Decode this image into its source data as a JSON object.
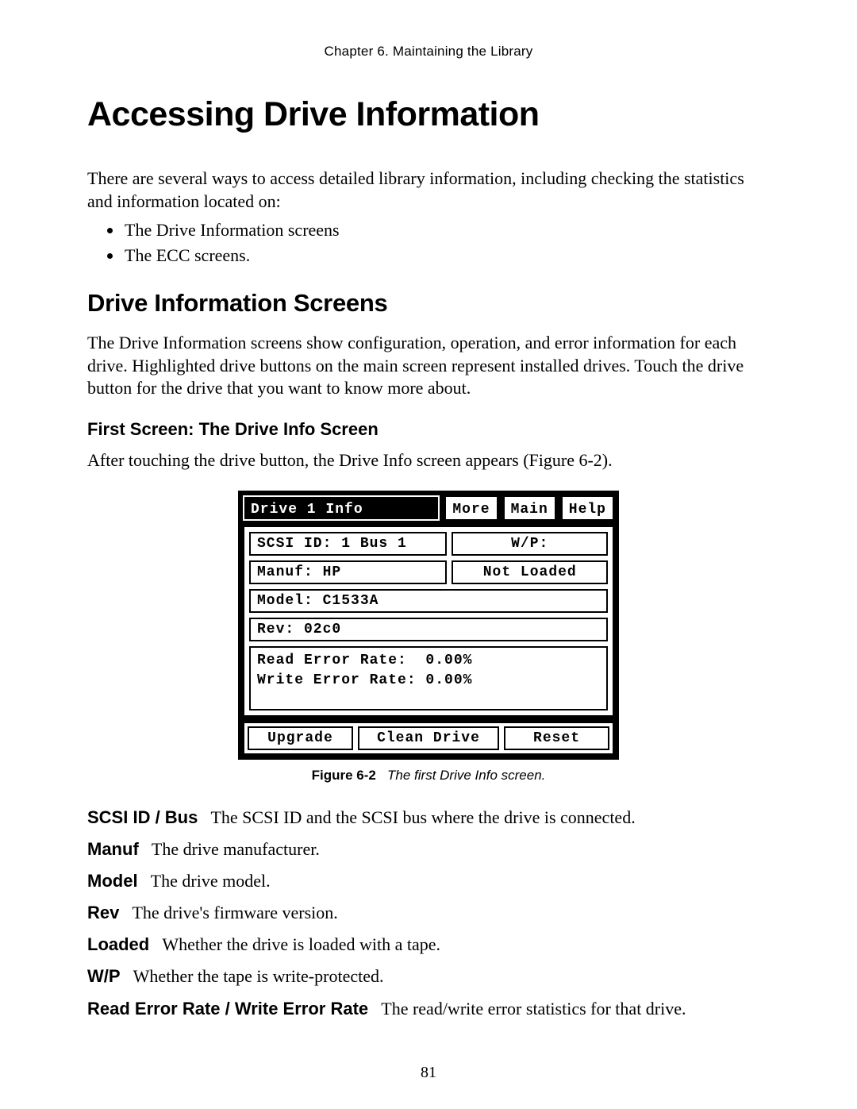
{
  "chapter_line": "Chapter 6.  Maintaining the Library",
  "title": "Accessing Drive Information",
  "intro": "There are several ways to access detailed library information, including checking the statistics and information located on:",
  "intro_bullets": [
    "The Drive Information screens",
    "The ECC screens."
  ],
  "section_title": "Drive Information Screens",
  "section_body": "The Drive Information screens show configuration, operation, and error information for each drive. Highlighted drive buttons on the main screen represent installed drives. Touch the drive button for the drive that you want to know more about.",
  "subsection_title": "First Screen: The Drive Info Screen",
  "subsection_body": "After touching the drive button, the Drive Info screen appears (Figure 6-2).",
  "screen": {
    "header_title": "Drive 1 Info",
    "top_buttons": [
      "More",
      "Main",
      "Help"
    ],
    "scsi": "SCSI ID: 1 Bus 1",
    "wp": "W/P:",
    "manuf": "Manuf: HP",
    "load": "Not Loaded",
    "model": "Model: C1533A",
    "rev": "Rev: 02c0",
    "read_rate": "Read Error Rate:  0.00%",
    "write_rate": "Write Error Rate: 0.00%",
    "bottom_buttons": [
      "Upgrade",
      "Clean Drive",
      "Reset"
    ]
  },
  "caption_label": "Figure 6-2",
  "caption_text": "The first Drive Info screen.",
  "definitions": [
    {
      "term": "SCSI ID / Bus",
      "desc": "The SCSI ID and the SCSI bus where the drive is connected."
    },
    {
      "term": "Manuf",
      "desc": "The drive manufacturer."
    },
    {
      "term": "Model",
      "desc": "The drive model."
    },
    {
      "term": "Rev",
      "desc": "The drive's firmware version."
    },
    {
      "term": "Loaded",
      "desc": "Whether the drive is loaded with a tape."
    },
    {
      "term": "W/P",
      "desc": "Whether the tape is write-protected."
    },
    {
      "term": "Read Error Rate / Write Error Rate",
      "desc": "The read/write error statistics for that drive."
    }
  ],
  "page_number": "81"
}
